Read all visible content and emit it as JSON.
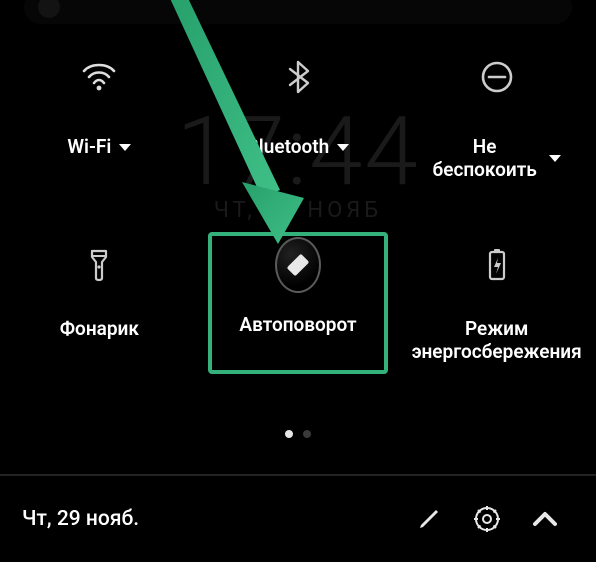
{
  "search": {
    "placeholder": ""
  },
  "ghost": {
    "time": "17:44",
    "date": "ЧТ, 29 НОЯБ"
  },
  "tiles": {
    "wifi": {
      "label": "Wi-Fi",
      "has_caret": true
    },
    "bluetooth": {
      "label": "Bluetooth",
      "has_caret": true
    },
    "dnd": {
      "label": "Не\nбеспокоить",
      "has_caret": true
    },
    "flashlight": {
      "label": "Фонарик",
      "has_caret": false
    },
    "autorotate": {
      "label": "Автоповорот",
      "has_caret": false
    },
    "battery": {
      "label": "Режим\nэнергосбережения",
      "has_caret": false
    }
  },
  "pagination": {
    "count": 2,
    "active_index": 0
  },
  "bottom": {
    "date": "Чт, 29 нояб."
  },
  "highlight": {
    "target": "autorotate"
  },
  "colors": {
    "highlight": "#34b17a"
  }
}
